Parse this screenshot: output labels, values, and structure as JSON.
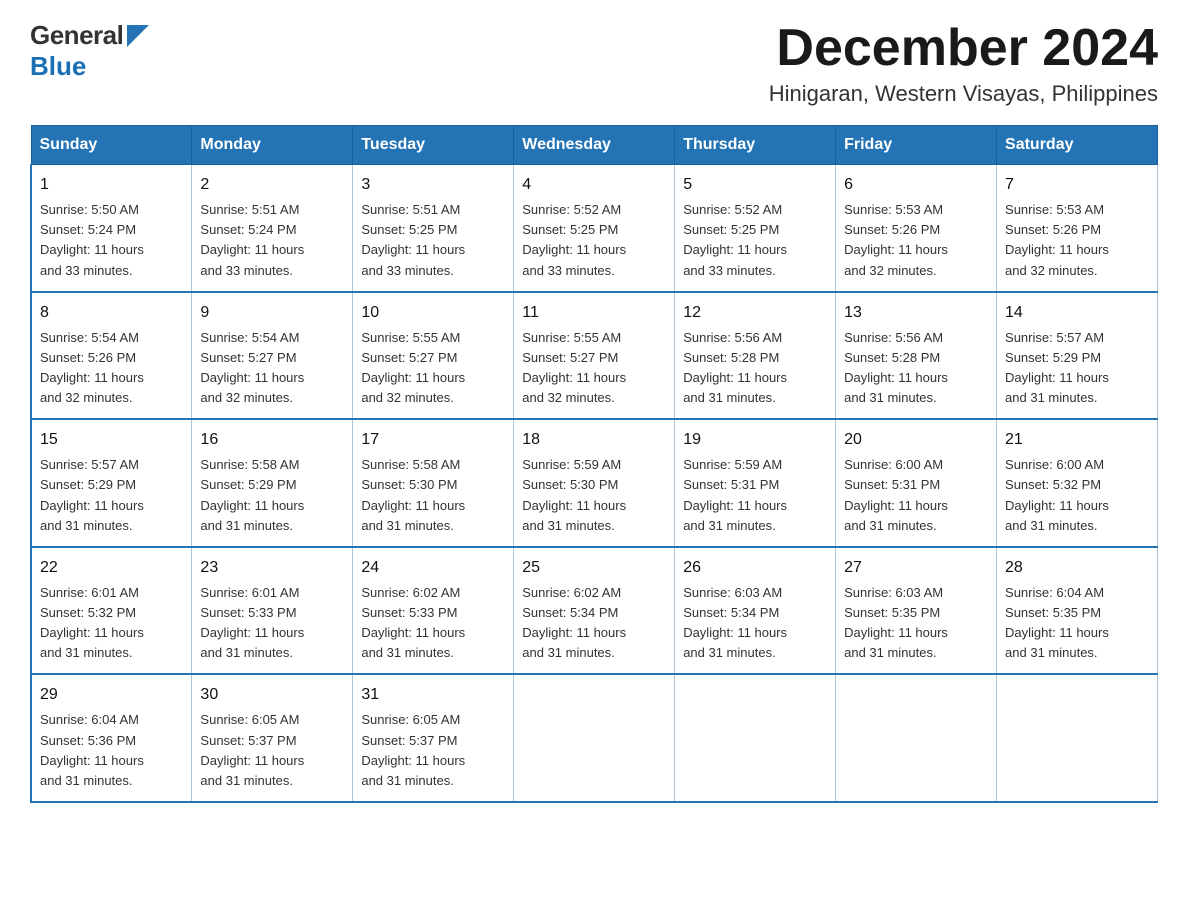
{
  "logo": {
    "general": "General",
    "blue": "Blue"
  },
  "title": "December 2024",
  "subtitle": "Hinigaran, Western Visayas, Philippines",
  "headers": [
    "Sunday",
    "Monday",
    "Tuesday",
    "Wednesday",
    "Thursday",
    "Friday",
    "Saturday"
  ],
  "weeks": [
    [
      {
        "day": "1",
        "info": "Sunrise: 5:50 AM\nSunset: 5:24 PM\nDaylight: 11 hours\nand 33 minutes."
      },
      {
        "day": "2",
        "info": "Sunrise: 5:51 AM\nSunset: 5:24 PM\nDaylight: 11 hours\nand 33 minutes."
      },
      {
        "day": "3",
        "info": "Sunrise: 5:51 AM\nSunset: 5:25 PM\nDaylight: 11 hours\nand 33 minutes."
      },
      {
        "day": "4",
        "info": "Sunrise: 5:52 AM\nSunset: 5:25 PM\nDaylight: 11 hours\nand 33 minutes."
      },
      {
        "day": "5",
        "info": "Sunrise: 5:52 AM\nSunset: 5:25 PM\nDaylight: 11 hours\nand 33 minutes."
      },
      {
        "day": "6",
        "info": "Sunrise: 5:53 AM\nSunset: 5:26 PM\nDaylight: 11 hours\nand 32 minutes."
      },
      {
        "day": "7",
        "info": "Sunrise: 5:53 AM\nSunset: 5:26 PM\nDaylight: 11 hours\nand 32 minutes."
      }
    ],
    [
      {
        "day": "8",
        "info": "Sunrise: 5:54 AM\nSunset: 5:26 PM\nDaylight: 11 hours\nand 32 minutes."
      },
      {
        "day": "9",
        "info": "Sunrise: 5:54 AM\nSunset: 5:27 PM\nDaylight: 11 hours\nand 32 minutes."
      },
      {
        "day": "10",
        "info": "Sunrise: 5:55 AM\nSunset: 5:27 PM\nDaylight: 11 hours\nand 32 minutes."
      },
      {
        "day": "11",
        "info": "Sunrise: 5:55 AM\nSunset: 5:27 PM\nDaylight: 11 hours\nand 32 minutes."
      },
      {
        "day": "12",
        "info": "Sunrise: 5:56 AM\nSunset: 5:28 PM\nDaylight: 11 hours\nand 31 minutes."
      },
      {
        "day": "13",
        "info": "Sunrise: 5:56 AM\nSunset: 5:28 PM\nDaylight: 11 hours\nand 31 minutes."
      },
      {
        "day": "14",
        "info": "Sunrise: 5:57 AM\nSunset: 5:29 PM\nDaylight: 11 hours\nand 31 minutes."
      }
    ],
    [
      {
        "day": "15",
        "info": "Sunrise: 5:57 AM\nSunset: 5:29 PM\nDaylight: 11 hours\nand 31 minutes."
      },
      {
        "day": "16",
        "info": "Sunrise: 5:58 AM\nSunset: 5:29 PM\nDaylight: 11 hours\nand 31 minutes."
      },
      {
        "day": "17",
        "info": "Sunrise: 5:58 AM\nSunset: 5:30 PM\nDaylight: 11 hours\nand 31 minutes."
      },
      {
        "day": "18",
        "info": "Sunrise: 5:59 AM\nSunset: 5:30 PM\nDaylight: 11 hours\nand 31 minutes."
      },
      {
        "day": "19",
        "info": "Sunrise: 5:59 AM\nSunset: 5:31 PM\nDaylight: 11 hours\nand 31 minutes."
      },
      {
        "day": "20",
        "info": "Sunrise: 6:00 AM\nSunset: 5:31 PM\nDaylight: 11 hours\nand 31 minutes."
      },
      {
        "day": "21",
        "info": "Sunrise: 6:00 AM\nSunset: 5:32 PM\nDaylight: 11 hours\nand 31 minutes."
      }
    ],
    [
      {
        "day": "22",
        "info": "Sunrise: 6:01 AM\nSunset: 5:32 PM\nDaylight: 11 hours\nand 31 minutes."
      },
      {
        "day": "23",
        "info": "Sunrise: 6:01 AM\nSunset: 5:33 PM\nDaylight: 11 hours\nand 31 minutes."
      },
      {
        "day": "24",
        "info": "Sunrise: 6:02 AM\nSunset: 5:33 PM\nDaylight: 11 hours\nand 31 minutes."
      },
      {
        "day": "25",
        "info": "Sunrise: 6:02 AM\nSunset: 5:34 PM\nDaylight: 11 hours\nand 31 minutes."
      },
      {
        "day": "26",
        "info": "Sunrise: 6:03 AM\nSunset: 5:34 PM\nDaylight: 11 hours\nand 31 minutes."
      },
      {
        "day": "27",
        "info": "Sunrise: 6:03 AM\nSunset: 5:35 PM\nDaylight: 11 hours\nand 31 minutes."
      },
      {
        "day": "28",
        "info": "Sunrise: 6:04 AM\nSunset: 5:35 PM\nDaylight: 11 hours\nand 31 minutes."
      }
    ],
    [
      {
        "day": "29",
        "info": "Sunrise: 6:04 AM\nSunset: 5:36 PM\nDaylight: 11 hours\nand 31 minutes."
      },
      {
        "day": "30",
        "info": "Sunrise: 6:05 AM\nSunset: 5:37 PM\nDaylight: 11 hours\nand 31 minutes."
      },
      {
        "day": "31",
        "info": "Sunrise: 6:05 AM\nSunset: 5:37 PM\nDaylight: 11 hours\nand 31 minutes."
      },
      null,
      null,
      null,
      null
    ]
  ]
}
